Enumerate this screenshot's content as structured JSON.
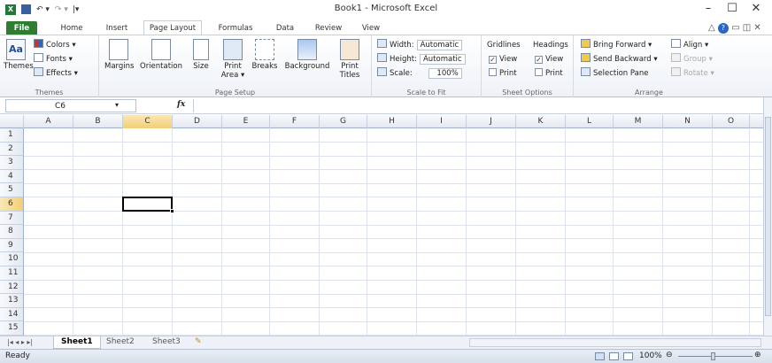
{
  "titlebar": {
    "title": "Book1 - Microsoft Excel"
  },
  "tabs": [
    {
      "label": "File"
    },
    {
      "label": "Home"
    },
    {
      "label": "Insert"
    },
    {
      "label": "Page Layout"
    },
    {
      "label": "Formulas"
    },
    {
      "label": "Data"
    },
    {
      "label": "Review"
    },
    {
      "label": "View"
    }
  ],
  "ribbon": {
    "themes": {
      "themes": "Themes",
      "colors": "Colors ▾",
      "fonts": "Fonts ▾",
      "effects": "Effects ▾",
      "group": "Themes"
    },
    "page_setup": {
      "margins": "Margins",
      "orientation": "Orientation",
      "size": "Size",
      "print_area": "Print Area ▾",
      "breaks": "Breaks",
      "background": "Background",
      "print_titles": "Print Titles",
      "group": "Page Setup"
    },
    "scale": {
      "width_label": "Width:",
      "width_value": "Automatic",
      "height_label": "Height:",
      "height_value": "Automatic",
      "scale_label": "Scale:",
      "scale_value": "100%",
      "group": "Scale to Fit"
    },
    "sheet_options": {
      "gridlines": "Gridlines",
      "headings": "Headings",
      "view1": "View",
      "view2": "View",
      "print1": "Print",
      "print2": "Print",
      "group": "Sheet Options"
    },
    "arrange": {
      "bring_forward": "Bring Forward ▾",
      "send_backward": "Send Backward ▾",
      "selection_pane": "Selection Pane",
      "align": "Align ▾",
      "group_btn": "Group ▾",
      "rotate": "Rotate ▾",
      "group": "Arrange"
    }
  },
  "formula_bar": {
    "name_box": "C6",
    "fx": "fx"
  },
  "columns": [
    "A",
    "B",
    "C",
    "D",
    "E",
    "F",
    "G",
    "H",
    "I",
    "J",
    "K",
    "L",
    "M",
    "N",
    "O"
  ],
  "rows": [
    "1",
    "2",
    "3",
    "4",
    "5",
    "6",
    "7",
    "8",
    "9",
    "10",
    "11",
    "12",
    "13",
    "14",
    "15"
  ],
  "sheets": [
    {
      "label": "Sheet1"
    },
    {
      "label": "Sheet2"
    },
    {
      "label": "Sheet3"
    }
  ],
  "status": {
    "ready": "Ready",
    "zoom": "100%"
  }
}
